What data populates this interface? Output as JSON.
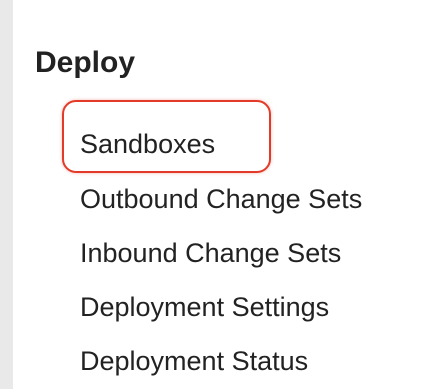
{
  "sidebar": {
    "section_title": "Deploy",
    "items": [
      {
        "label": "Sandboxes",
        "highlighted": true
      },
      {
        "label": "Outbound Change Sets"
      },
      {
        "label": "Inbound Change Sets"
      },
      {
        "label": "Deployment Settings"
      },
      {
        "label": "Deployment Status"
      }
    ]
  },
  "colors": {
    "text": "#222222",
    "highlight": "#e23b2a",
    "background": "#ffffff",
    "gutter": "#e9e9e9"
  }
}
